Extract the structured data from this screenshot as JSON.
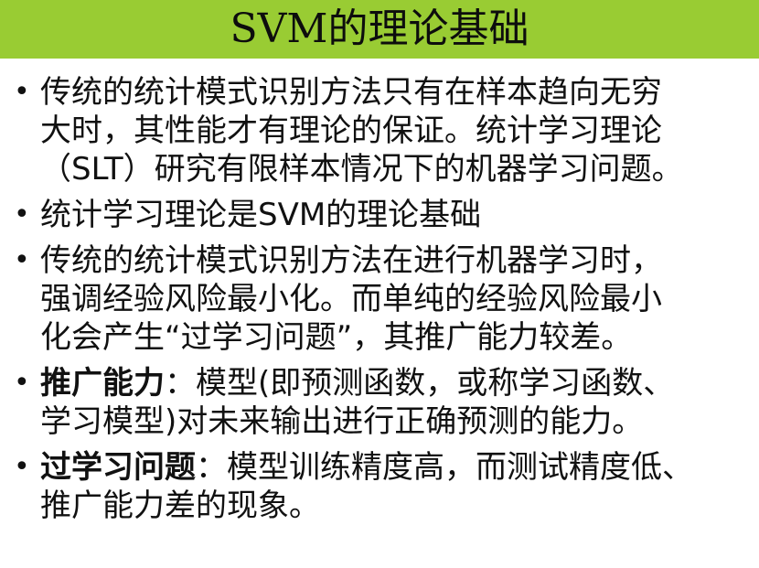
{
  "theme": {
    "title_bar_color": "#99cc33",
    "text_color": "#111111"
  },
  "title": "SVM的理论基础",
  "bullets": [
    {
      "lines": [
        "传统的统计模式识别方法只有在样本趋向无穷",
        "大时，其性能才有理论的保证。统计学习理论",
        "（SLT）研究有限样本情况下的机器学习问题。"
      ]
    },
    {
      "lines": [
        "统计学习理论是SVM的理论基础"
      ]
    },
    {
      "lines": [
        "传统的统计模式识别方法在进行机器学习时，",
        "强调经验风险最小化。而单纯的经验风险最小",
        "化会产生“过学习问题”，其推广能力较差。"
      ]
    },
    {
      "term": "推广能力",
      "first_line_rest": "：模型(即预测函数，或称学习函数、",
      "lines": [
        "学习模型)对未来输出进行正确预测的能力。"
      ]
    },
    {
      "term": "过学习问题",
      "first_line_rest": "：模型训练精度高，而测试精度低、",
      "lines": [
        "推广能力差的现象。"
      ]
    }
  ]
}
